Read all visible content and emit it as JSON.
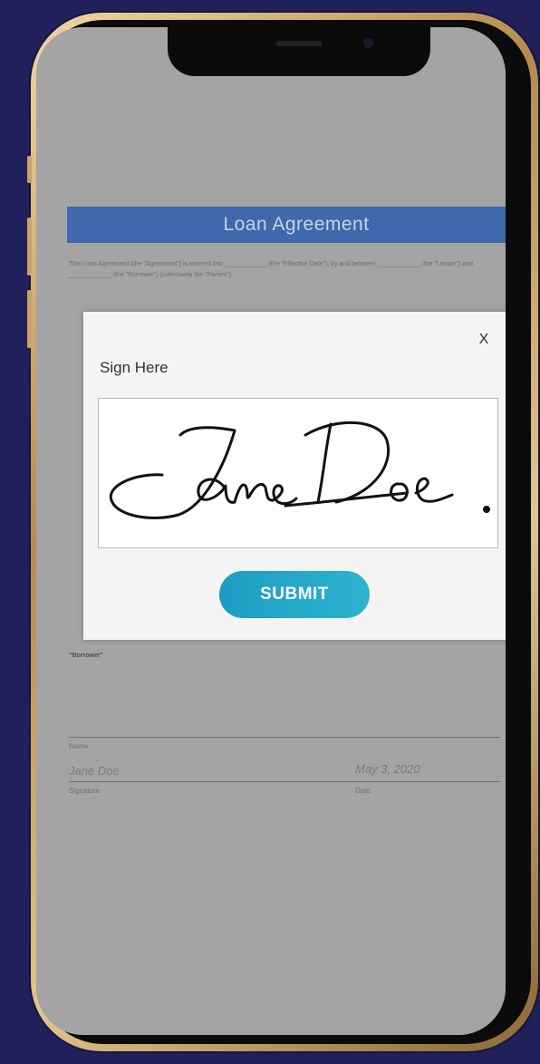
{
  "document": {
    "title": "Loan Agreement",
    "intro_text": "This Loan Agreement (the \"Agreement\") is entered into ____________ (the \"Effective Date\"), by and between ____________ (the \"Lender\") and ____________ (the \"Borrower\") (collectively the \"Parties\").",
    "borrower_label": "\"Borrower\"",
    "name_label": "Name",
    "signer_name": "Jane Doe",
    "signed_date": "May 3, 2020",
    "signature_caption": "Signature",
    "date_caption": "Date"
  },
  "modal": {
    "title": "Sign Here",
    "close_label": "X",
    "submit_label": "SUBMIT"
  },
  "colors": {
    "background": "#20205a",
    "header": "#3f68ad",
    "submit": "#1e9cc4"
  }
}
